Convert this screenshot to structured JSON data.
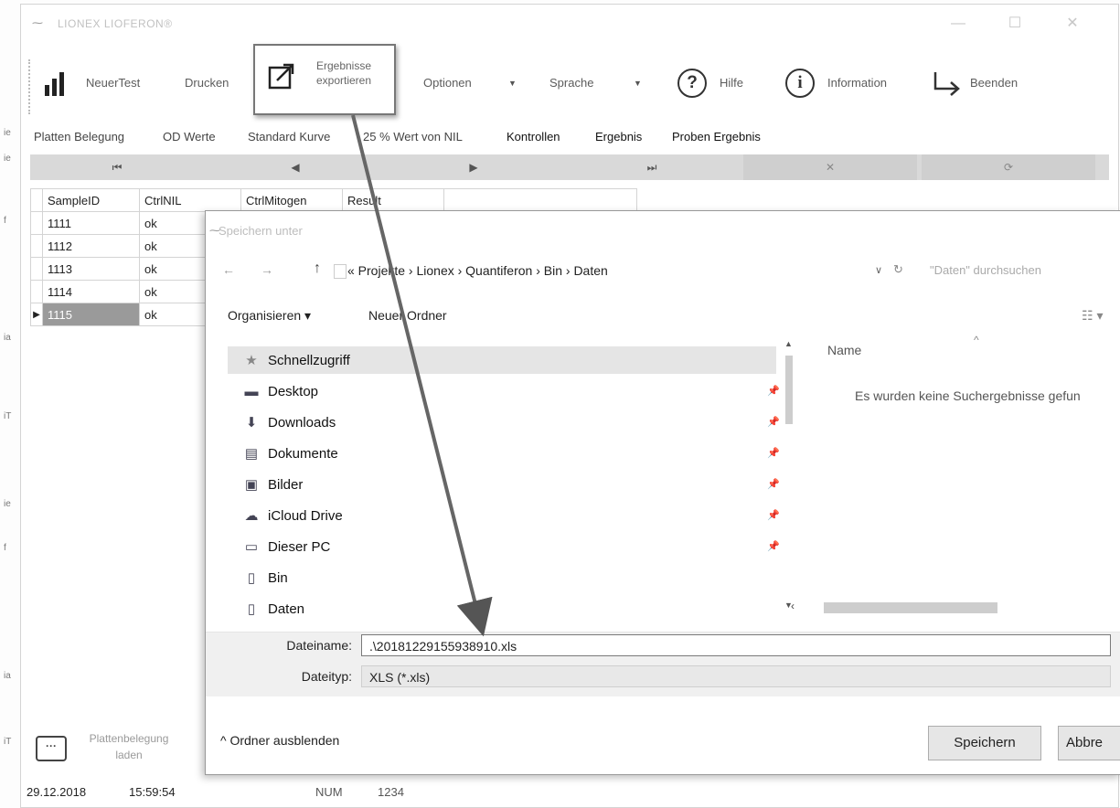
{
  "window": {
    "title": "LIONEX LIOFERON®",
    "controls": [
      "—",
      "☐",
      "✕"
    ]
  },
  "toolbar": {
    "new_test": "NeuerTest",
    "print": "Drucken",
    "export": "Ergebnisse exportieren",
    "options": "Optionen",
    "language": "Sprache",
    "help": "Hilfe",
    "information": "Information",
    "exit": "Beenden"
  },
  "tabs": [
    "Platten Belegung",
    "OD Werte",
    "Standard Kurve",
    "25 % Wert von NIL",
    "Kontrollen",
    "Ergebnis",
    "Proben Ergebnis"
  ],
  "navigator": [
    "⏮",
    "◀",
    "▶",
    "⏭",
    "✕",
    "⟳"
  ],
  "grid": {
    "headers": [
      "SampleID",
      "CtrlNIL",
      "CtrlMitogen",
      "Result"
    ],
    "rows": [
      [
        "1111",
        "ok"
      ],
      [
        "1112",
        "ok"
      ],
      [
        "1113",
        "ok"
      ],
      [
        "1114",
        "ok"
      ],
      [
        "1115",
        "ok"
      ]
    ],
    "selected_row": 4
  },
  "load_plate": "Plattenbelegung laden",
  "status": {
    "date": "29.12.2018",
    "time": "15:59:54",
    "num": "NUM",
    "value": "1234"
  },
  "dialog": {
    "title": "Speichern unter",
    "breadcrumb": "«  Projekte  ›  Lionex  ›  Quantiferon  ›  Bin  ›  Daten",
    "search_placeholder": "\"Daten\" durchsuchen",
    "organize": "Organisieren ▾",
    "new_folder": "Neuer Ordner",
    "nav_items": [
      {
        "label": "Schnellzugriff",
        "icon": "star-icon"
      },
      {
        "label": "Desktop",
        "icon": "desktop-icon"
      },
      {
        "label": "Downloads",
        "icon": "download-icon"
      },
      {
        "label": "Dokumente",
        "icon": "document-icon"
      },
      {
        "label": "Bilder",
        "icon": "pictures-icon"
      },
      {
        "label": "iCloud Drive",
        "icon": "cloud-icon"
      },
      {
        "label": "Dieser PC",
        "icon": "computer-icon"
      },
      {
        "label": "Bin",
        "icon": "folder-icon"
      },
      {
        "label": "Daten",
        "icon": "folder-icon"
      }
    ],
    "column_name": "Name",
    "empty_message": "Es wurden keine Suchergebnisse gefun",
    "filename_label": "Dateiname:",
    "filename_value": ".\\20181229155938910.xls",
    "filetype_label": "Dateityp:",
    "filetype_value": "XLS (*.xls)",
    "hide_folders": "Ordner ausblenden",
    "save": "Speichern",
    "cancel": "Abbre"
  }
}
